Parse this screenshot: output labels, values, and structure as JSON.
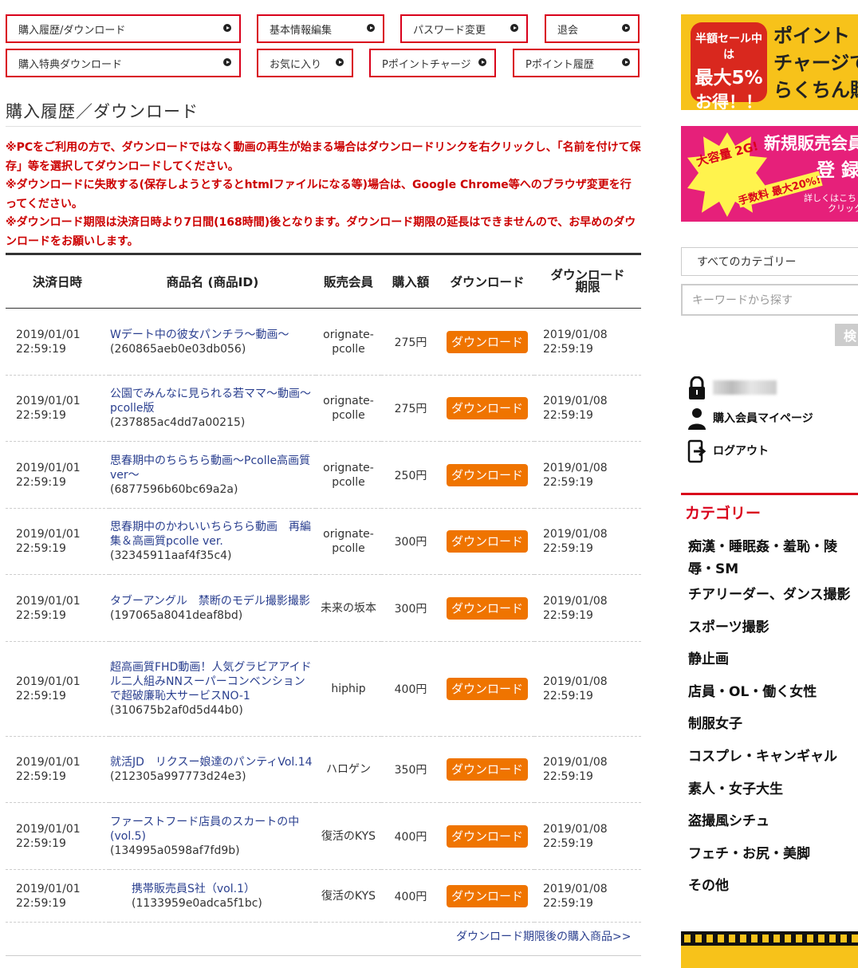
{
  "nav": {
    "row1": [
      {
        "label": "購入履歴/ダウンロード"
      },
      {
        "label": "基本情報編集"
      },
      {
        "label": "パスワード変更"
      },
      {
        "label": "退会"
      }
    ],
    "row2": [
      {
        "label": "購入特典ダウンロード"
      },
      {
        "label": "お気に入り"
      },
      {
        "label": "Pポイントチャージ"
      },
      {
        "label": "Pポイント履歴"
      }
    ]
  },
  "page_title": "購入履歴／ダウンロード",
  "notices": [
    "※PCをご利用の方で、ダウンロードではなく動画の再生が始まる場合はダウンロードリンクを右クリックし、「名前を付けて保存」等を選択してダウンロードしてください。",
    "※ダウンロードに失敗する(保存しようとするとhtmlファイルになる等)場合は、Google Chrome等へのブラウザ変更を行ってください。",
    "※ダウンロード期限は決済日時より7日間(168時間)後となります。ダウンロード期限の延長はできませんので、お早めのダウンロードをお願いします。"
  ],
  "table": {
    "headers": {
      "date": "決済日時",
      "product": "商品名 (商品ID)",
      "seller": "販売会員",
      "price": "購入額",
      "download": "ダウンロード",
      "expiry_line1": "ダウンロード",
      "expiry_line2": "期限"
    },
    "download_label": "ダウンロード",
    "rows": [
      {
        "date1": "2019/01/01",
        "date2": "22:59:19",
        "name": "Wデート中の彼女パンチラ～動画～",
        "id": "(260865aeb0e03db056)",
        "seller1": "orignate-",
        "seller2": "pcolle",
        "price": "275円",
        "exp1": "2019/01/08",
        "exp2": "22:59:19"
      },
      {
        "date1": "2019/01/01",
        "date2": "22:59:19",
        "name": "公園でみんなに見られる若ママ～動画～pcolle版",
        "id": "(237885ac4dd7a00215)",
        "seller1": "orignate-",
        "seller2": "pcolle",
        "price": "275円",
        "exp1": "2019/01/08",
        "exp2": "22:59:19"
      },
      {
        "date1": "2019/01/01",
        "date2": "22:59:19",
        "name": "思春期中のちらちら動画～Pcolle高画質ver～",
        "id": "(6877596b60bc69a2a)",
        "seller1": "orignate-",
        "seller2": "pcolle",
        "price": "250円",
        "exp1": "2019/01/08",
        "exp2": "22:59:19"
      },
      {
        "date1": "2019/01/01",
        "date2": "22:59:19",
        "name": "思春期中のかわいいちらちら動画　再編集＆高画質pcolle ver.",
        "id": "(32345911aaf4f35c4)",
        "seller1": "orignate-",
        "seller2": "pcolle",
        "price": "300円",
        "exp1": "2019/01/08",
        "exp2": "22:59:19"
      },
      {
        "date1": "2019/01/01",
        "date2": "22:59:19",
        "name": "タブーアングル　禁断のモデル撮影撮影",
        "id": "(197065a8041deaf8bd)",
        "seller1": "未来の坂本",
        "seller2": "",
        "price": "300円",
        "exp1": "2019/01/08",
        "exp2": "22:59:19"
      },
      {
        "date1": "2019/01/01",
        "date2": "22:59:19",
        "name": "超高画質FHD動画！人気グラビアアイドル二人組みNNスーパーコンベンションで超破廉恥大サービスNO-1",
        "id": "(310675b2af0d5d44b0)",
        "seller1": "hiphip",
        "seller2": "",
        "price": "400円",
        "exp1": "2019/01/08",
        "exp2": "22:59:19"
      },
      {
        "date1": "2019/01/01",
        "date2": "22:59:19",
        "name": "就活JD　リクスー娘達のパンティVol.14",
        "id": "(212305a997773d24e3)",
        "seller1": "ハロゲン",
        "seller2": "",
        "price": "350円",
        "exp1": "2019/01/08",
        "exp2": "22:59:19"
      },
      {
        "date1": "2019/01/01",
        "date2": "22:59:19",
        "name": "ファーストフード店員のスカートの中(vol.5)",
        "id": "(134995a0598af7fd9b)",
        "seller1": "復活のKYS",
        "seller2": "",
        "price": "400円",
        "exp1": "2019/01/08",
        "exp2": "22:59:19"
      },
      {
        "date1": "2019/01/01",
        "date2": "22:59:19",
        "name": "携帯販売員S社（vol.1）",
        "id": "(1133959e0adca5f1bc)",
        "seller1": "復活のKYS",
        "seller2": "",
        "price": "400円",
        "exp1": "2019/01/08",
        "exp2": "22:59:19"
      }
    ]
  },
  "more_link": "ダウンロード期限後の購入商品>>",
  "sidebar": {
    "banner1": {
      "badge1": "半額セール中は",
      "badge2": "最大5%",
      "badge3": "お得！！",
      "line1": "ポイント",
      "line2": "チャージで",
      "line3": "らくちん購"
    },
    "banner2": {
      "burst1": "大容量 2G!",
      "burst2": "手数料 最大20%!",
      "line1": "新規販売会員",
      "line2": "登 録",
      "line3": "詳しくはこちら",
      "line4": "クリック"
    },
    "category_select": "すべてのカテゴリー",
    "search_placeholder": "キーワードから探す",
    "search_button": "検",
    "mypage": "購入会員マイページ",
    "logout": "ログアウト",
    "category_heading": "カテゴリー",
    "categories": [
      "痴漢・睡眠姦・羞恥・陵辱・SM",
      "チアリーダー、ダンス撮影",
      "スポーツ撮影",
      "静止画",
      "店員・OL・働く女性",
      "制服女子",
      "コスプレ・キャンギャル",
      "素人・女子大生",
      "盗撮風シチュ",
      "フェチ・お尻・美脚",
      "その他"
    ]
  },
  "colors": {
    "accent": "#d9001b",
    "button": "#ef7400",
    "link": "#2a3f8f"
  }
}
